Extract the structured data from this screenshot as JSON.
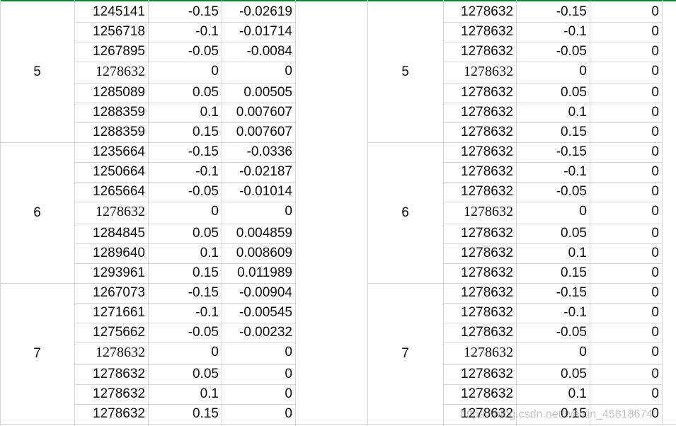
{
  "left_table": {
    "groups": [
      {
        "label": "5",
        "rows": [
          [
            "1245141",
            "-0.15",
            "-0.02619"
          ],
          [
            "1256718",
            "-0.1",
            "-0.01714"
          ],
          [
            "1267895",
            "-0.05",
            "-0.0084"
          ],
          [
            "1278632",
            "0",
            "0"
          ],
          [
            "1285089",
            "0.05",
            "0.00505"
          ],
          [
            "1288359",
            "0.1",
            "0.007607"
          ],
          [
            "1288359",
            "0.15",
            "0.007607"
          ]
        ]
      },
      {
        "label": "6",
        "rows": [
          [
            "1235664",
            "-0.15",
            "-0.0336"
          ],
          [
            "1250664",
            "-0.1",
            "-0.02187"
          ],
          [
            "1265664",
            "-0.05",
            "-0.01014"
          ],
          [
            "1278632",
            "0",
            "0"
          ],
          [
            "1284845",
            "0.05",
            "0.004859"
          ],
          [
            "1289640",
            "0.1",
            "0.008609"
          ],
          [
            "1293961",
            "0.15",
            "0.011989"
          ]
        ]
      },
      {
        "label": "7",
        "rows": [
          [
            "1267073",
            "-0.15",
            "-0.00904"
          ],
          [
            "1271661",
            "-0.1",
            "-0.00545"
          ],
          [
            "1275662",
            "-0.05",
            "-0.00232"
          ],
          [
            "1278632",
            "0",
            "0"
          ],
          [
            "1278632",
            "0.05",
            "0"
          ],
          [
            "1278632",
            "0.1",
            "0"
          ],
          [
            "1278632",
            "0.15",
            "0"
          ]
        ]
      }
    ]
  },
  "right_table": {
    "groups": [
      {
        "label": "5",
        "rows": [
          [
            "1278632",
            "-0.15",
            "0"
          ],
          [
            "1278632",
            "-0.1",
            "0"
          ],
          [
            "1278632",
            "-0.05",
            "0"
          ],
          [
            "1278632",
            "0",
            "0"
          ],
          [
            "1278632",
            "0.05",
            "0"
          ],
          [
            "1278632",
            "0.1",
            "0"
          ],
          [
            "1278632",
            "0.15",
            "0"
          ]
        ]
      },
      {
        "label": "6",
        "rows": [
          [
            "1278632",
            "-0.15",
            "0"
          ],
          [
            "1278632",
            "-0.1",
            "0"
          ],
          [
            "1278632",
            "-0.05",
            "0"
          ],
          [
            "1278632",
            "0",
            "0"
          ],
          [
            "1278632",
            "0.05",
            "0"
          ],
          [
            "1278632",
            "0.1",
            "0"
          ],
          [
            "1278632",
            "0.15",
            "0"
          ]
        ]
      },
      {
        "label": "7",
        "rows": [
          [
            "1278632",
            "-0.15",
            "0"
          ],
          [
            "1278632",
            "-0.1",
            "0"
          ],
          [
            "1278632",
            "-0.05",
            "0"
          ],
          [
            "1278632",
            "0",
            "0"
          ],
          [
            "1278632",
            "0.05",
            "0"
          ],
          [
            "1278632",
            "0.1",
            "0"
          ],
          [
            "1278632",
            "0.15",
            "0"
          ]
        ]
      }
    ]
  },
  "watermark": "https://blog.csdn.net/weixin_45818674",
  "colors": {
    "header_accent": "#1f7a3f",
    "gridline": "#d4d4d4"
  }
}
